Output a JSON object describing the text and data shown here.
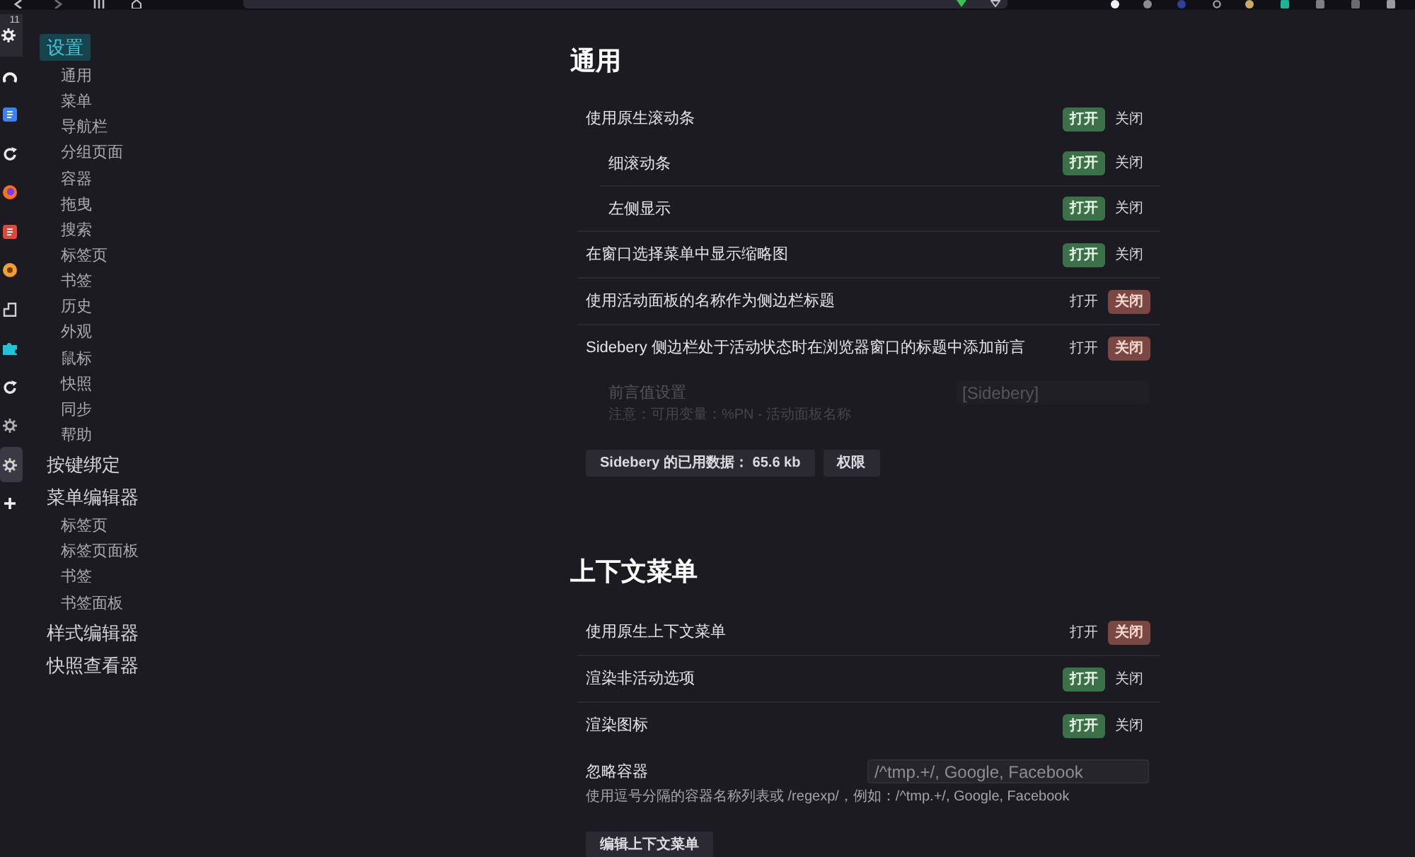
{
  "icon_bar": {
    "badge": "11",
    "items": [
      {
        "kind": "arc",
        "color": "#f0f0f0",
        "selected": false
      },
      {
        "kind": "square",
        "color": "#3b82f6",
        "selected": false
      },
      {
        "kind": "refresh",
        "color": "#e8e8e8",
        "selected": false
      },
      {
        "kind": "globe",
        "color": "#f97316",
        "selected": false
      },
      {
        "kind": "square",
        "color": "#e0463a",
        "selected": false
      },
      {
        "kind": "ring",
        "color": "#f0a030",
        "selected": false
      },
      {
        "kind": "tab",
        "color": "#d0d0d0",
        "selected": false
      },
      {
        "kind": "puzzle",
        "color": "#22c3d6",
        "selected": false
      },
      {
        "kind": "refresh",
        "color": "#e8e8e8",
        "selected": false
      },
      {
        "kind": "gear",
        "color": "#b0b0b0",
        "selected": false
      },
      {
        "kind": "gear",
        "color": "#d0d0d0",
        "selected": true
      },
      {
        "kind": "plus",
        "color": "#f0f0f0",
        "selected": false
      }
    ]
  },
  "nav": {
    "items": [
      {
        "label": "设置",
        "selected": true,
        "children": [
          {
            "label": "通用",
            "selected": false
          },
          {
            "label": "菜单",
            "selected": false
          },
          {
            "label": "导航栏",
            "selected": false
          },
          {
            "label": "分组页面",
            "selected": false
          },
          {
            "label": "容器",
            "selected": false
          },
          {
            "label": "拖曳",
            "selected": false
          },
          {
            "label": "搜索",
            "selected": false
          },
          {
            "label": "标签页",
            "selected": false
          },
          {
            "label": "书签",
            "selected": false
          },
          {
            "label": "历史",
            "selected": false
          },
          {
            "label": "外观",
            "selected": false
          },
          {
            "label": "鼠标",
            "selected": false
          },
          {
            "label": "快照",
            "selected": false
          },
          {
            "label": "同步",
            "selected": false
          },
          {
            "label": "帮助",
            "selected": false
          }
        ]
      },
      {
        "label": "按键绑定",
        "selected": false
      },
      {
        "label": "菜单编辑器",
        "selected": false,
        "children": [
          {
            "label": "标签页",
            "selected": false
          },
          {
            "label": "标签页面板",
            "selected": false
          },
          {
            "label": "书签",
            "selected": false
          },
          {
            "label": "书签面板",
            "selected": false
          }
        ]
      },
      {
        "label": "样式编辑器",
        "selected": false
      },
      {
        "label": "快照查看器",
        "selected": false
      }
    ]
  },
  "sections": [
    {
      "title": "通用",
      "rows": [
        {
          "kind": "toggle",
          "label": "使用原生滚动条",
          "options": [
            {
              "label": "打开",
              "selected": true
            },
            {
              "label": "关闭",
              "selected": false
            }
          ],
          "children": [
            {
              "kind": "toggle",
              "label": "细滚动条",
              "options": [
                {
                  "label": "打开",
                  "selected": true
                },
                {
                  "label": "关闭",
                  "selected": false
                }
              ]
            },
            {
              "kind": "toggle",
              "label": "左侧显示",
              "options": [
                {
                  "label": "打开",
                  "selected": true
                },
                {
                  "label": "关闭",
                  "selected": false
                }
              ]
            }
          ]
        },
        {
          "kind": "toggle",
          "label": "在窗口选择菜单中显示缩略图",
          "options": [
            {
              "label": "打开",
              "selected": true
            },
            {
              "label": "关闭",
              "selected": false
            }
          ]
        },
        {
          "kind": "toggle",
          "label": "使用活动面板的名称作为侧边栏标题",
          "options": [
            {
              "label": "打开",
              "selected": false
            },
            {
              "label": "关闭",
              "selected": true
            }
          ]
        },
        {
          "kind": "toggle",
          "label": "Sidebery 侧边栏处于活动状态时在浏览器窗口的标题中添加前言",
          "options": [
            {
              "label": "打开",
              "selected": false
            },
            {
              "label": "关闭",
              "selected": true
            }
          ],
          "children": [
            {
              "kind": "text_input",
              "label": "前言值设置",
              "value": "[Sidebery]",
              "disabled": true,
              "note": "注意：可用变量：%PN - 活动面板名称"
            }
          ]
        }
      ],
      "buttons": [
        "Sidebery 的已用数据： 65.6 kb",
        "权限"
      ]
    },
    {
      "title": "上下文菜单",
      "rows": [
        {
          "kind": "toggle",
          "label": "使用原生上下文菜单",
          "options": [
            {
              "label": "打开",
              "selected": false
            },
            {
              "label": "关闭",
              "selected": true
            }
          ]
        },
        {
          "kind": "toggle",
          "label": "渲染非活动选项",
          "options": [
            {
              "label": "打开",
              "selected": true
            },
            {
              "label": "关闭",
              "selected": false
            }
          ]
        },
        {
          "kind": "toggle",
          "label": "渲染图标",
          "options": [
            {
              "label": "打开",
              "selected": true
            },
            {
              "label": "关闭",
              "selected": false
            }
          ]
        },
        {
          "kind": "text_input",
          "label": "忽略容器",
          "placeholder": "/^tmp.+/, Google, Facebook",
          "disabled": false,
          "note": "使用逗号分隔的容器名称列表或 /regexp/，例如：/^tmp.+/, Google, Facebook"
        }
      ],
      "buttons": [
        "编辑上下文菜单"
      ]
    }
  ]
}
